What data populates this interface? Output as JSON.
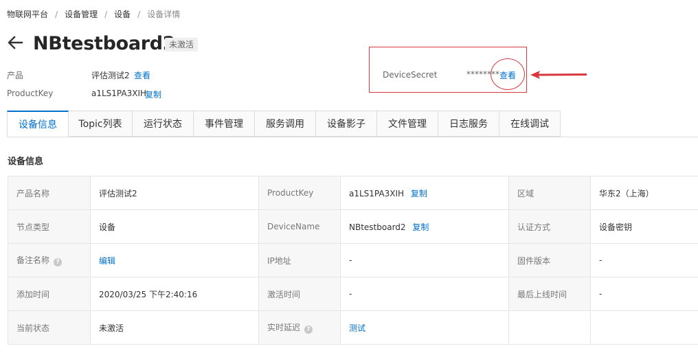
{
  "breadcrumb": {
    "items": [
      "物联网平台",
      "设备管理",
      "设备"
    ],
    "current": "设备详情",
    "separator": "/"
  },
  "header": {
    "title": "NBtestboard2",
    "status_badge": "未激活"
  },
  "meta": {
    "product_label": "产品",
    "product_value": "评估测试2",
    "product_view": "查看",
    "productkey_label": "ProductKey",
    "productkey_value": "a1LS1PA3XIH",
    "productkey_copy": "复制",
    "secret_label": "DeviceSecret",
    "secret_value": "********",
    "secret_view": "查看"
  },
  "tabs": [
    {
      "label": "设备信息",
      "active": true
    },
    {
      "label": "Topic列表"
    },
    {
      "label": "运行状态"
    },
    {
      "label": "事件管理"
    },
    {
      "label": "服务调用"
    },
    {
      "label": "设备影子"
    },
    {
      "label": "文件管理"
    },
    {
      "label": "日志服务"
    },
    {
      "label": "在线调试"
    }
  ],
  "section": {
    "title": "设备信息"
  },
  "table": {
    "rows": [
      [
        {
          "key": "产品名称",
          "value": "评估测试2"
        },
        {
          "key": "ProductKey",
          "value": "a1LS1PA3XIH",
          "link": "复制"
        },
        {
          "key": "区域",
          "value": "华东2（上海）"
        }
      ],
      [
        {
          "key": "节点类型",
          "value": "设备"
        },
        {
          "key": "DeviceName",
          "value": "NBtestboard2",
          "link": "复制"
        },
        {
          "key": "认证方式",
          "value": "设备密钥"
        }
      ],
      [
        {
          "key": "备注名称",
          "help": "?",
          "link": "编辑"
        },
        {
          "key": "IP地址",
          "value": "-"
        },
        {
          "key": "固件版本",
          "value": "-"
        }
      ],
      [
        {
          "key": "添加时间",
          "value": "2020/03/25 下午2:40:16"
        },
        {
          "key": "激活时间",
          "value": "-"
        },
        {
          "key": "最后上线时间",
          "value": "-"
        }
      ],
      [
        {
          "key": "当前状态",
          "value": "未激活"
        },
        {
          "key": "实时延迟",
          "help": "?",
          "link": "测试"
        },
        {
          "key": "",
          "value": ""
        }
      ]
    ]
  },
  "colors": {
    "link": "#0070cc",
    "annotation": "#d9363e",
    "key_bg": "#f7f7f7",
    "border": "#e5e5e5"
  }
}
